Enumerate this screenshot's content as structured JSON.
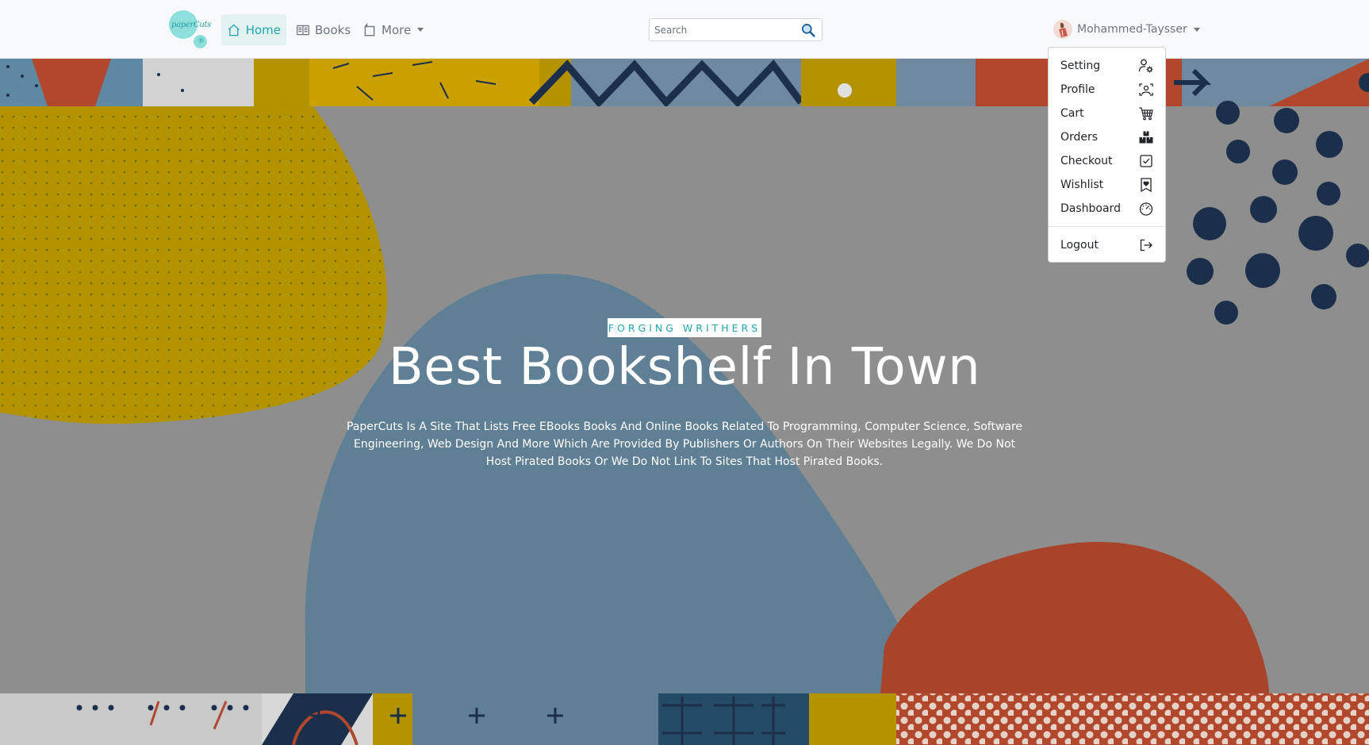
{
  "brand": {
    "logo_text": "paperCuts",
    "logo_mark": "®"
  },
  "nav": {
    "home": {
      "label": "Home",
      "icon": "house-icon"
    },
    "books": {
      "label": "Books",
      "icon": "book-open-icon"
    },
    "more": {
      "label": "More",
      "icon": "box-icon"
    }
  },
  "search": {
    "placeholder": "Search",
    "value": "",
    "icon": "search-icon"
  },
  "user": {
    "name": "Mohammed-Taysser",
    "avatar_icon": "user-avatar-icon"
  },
  "user_menu": {
    "items": [
      {
        "label": "Setting",
        "icon": "person-gear-icon"
      },
      {
        "label": "Profile",
        "icon": "person-badge-icon"
      },
      {
        "label": "Cart",
        "icon": "cart-icon"
      },
      {
        "label": "Orders",
        "icon": "boxes-icon"
      },
      {
        "label": "Checkout",
        "icon": "check-square-icon"
      },
      {
        "label": "Wishlist",
        "icon": "bookmark-heart-icon"
      },
      {
        "label": "Dashboard",
        "icon": "speedometer-icon"
      }
    ],
    "logout": {
      "label": "Logout",
      "icon": "box-arrow-right-icon"
    }
  },
  "hero": {
    "tagline": "FORGING WRITHERS",
    "title": "Best Bookshelf In Town",
    "description": "PaperCuts Is A Site That Lists Free EBooks Books And Online Books Related To Programming, Computer Science, Software Engineering, Web Design And More Which Are Provided By Publishers Or Authors On Their Websites Legally. We Do Not Host Pirated Books Or We Do Not Link To Sites That Host Pirated Books."
  },
  "colors": {
    "accent": "#20a5ad",
    "hero_overlay": "#8e8e8e",
    "mustard": "#b39300",
    "slate_blue": "#5f7f95",
    "rust": "#a8442a",
    "navy": "#1c2f4a"
  }
}
